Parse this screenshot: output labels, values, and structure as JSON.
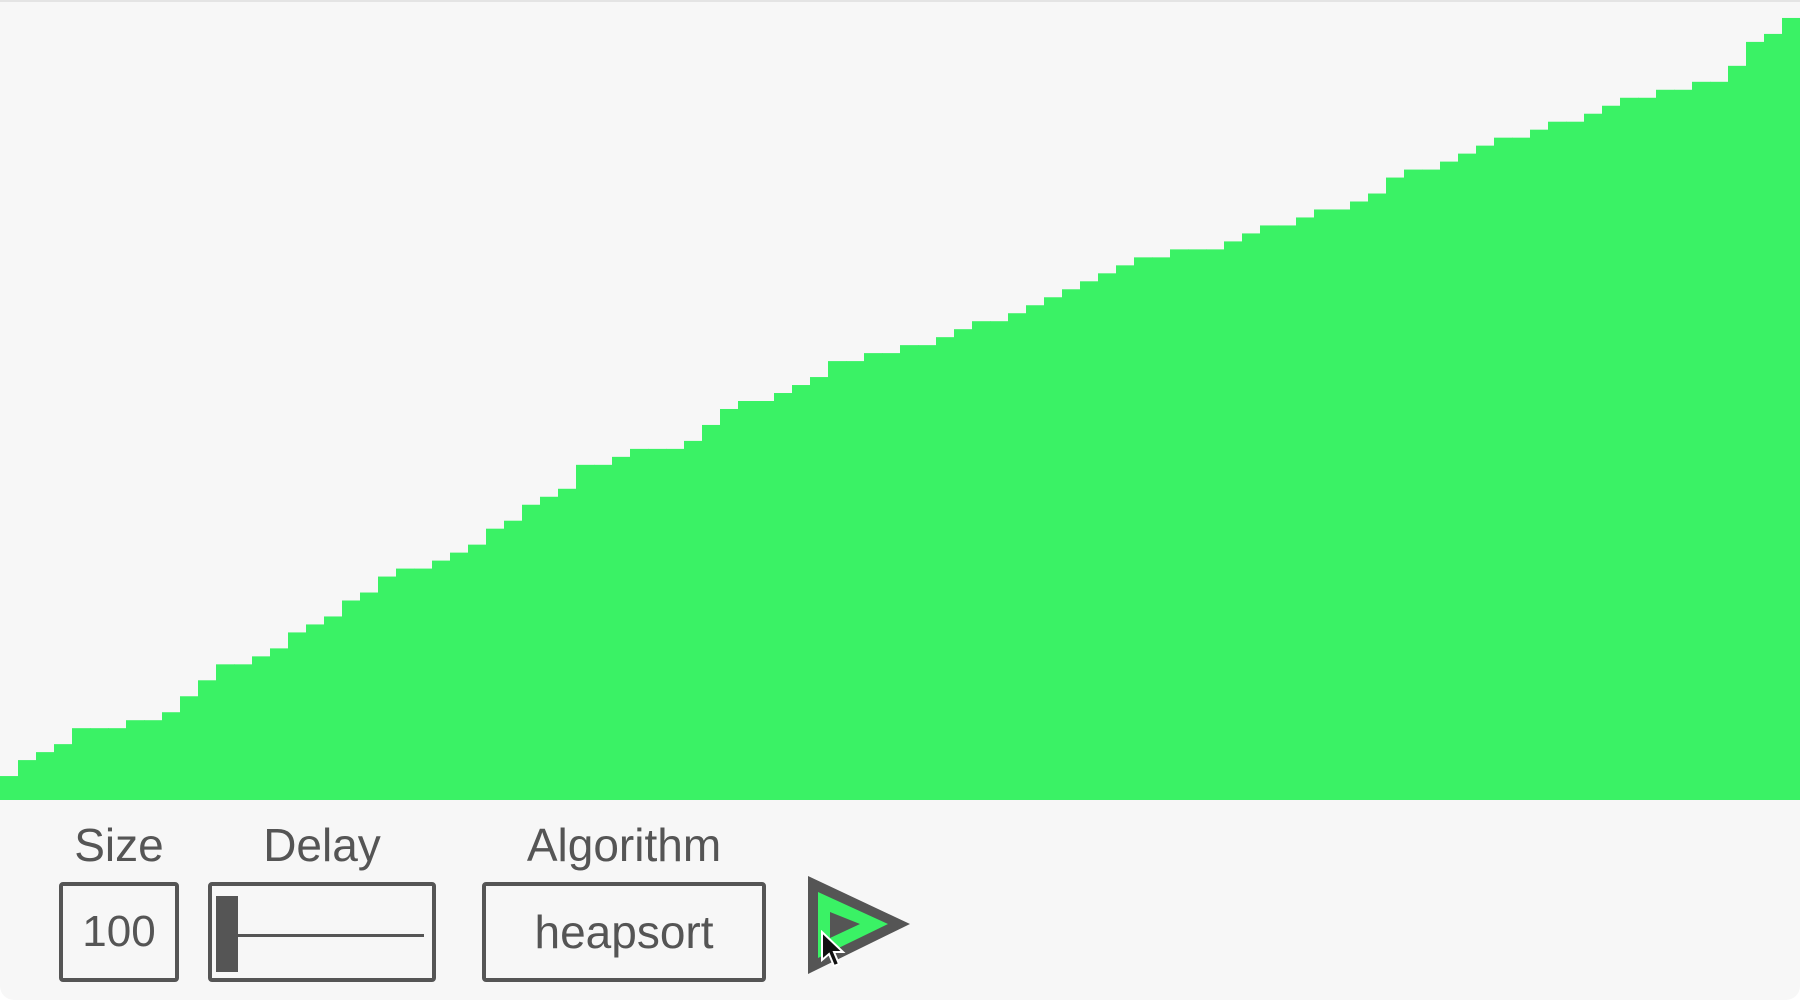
{
  "controls": {
    "size": {
      "label": "Size",
      "value": "100"
    },
    "delay": {
      "label": "Delay",
      "value": 0
    },
    "algorithm": {
      "label": "Algorithm",
      "value": "heapsort"
    },
    "play": {
      "icon": "play-icon"
    }
  },
  "colors": {
    "bar": "#3af265",
    "background": "#f7f7f7",
    "control": "#555555"
  },
  "chart_data": {
    "type": "bar",
    "count": 100,
    "ylim": [
      0,
      100
    ],
    "values": [
      3,
      5,
      6,
      7,
      9,
      9,
      9,
      10,
      10,
      11,
      13,
      15,
      17,
      17,
      18,
      19,
      21,
      22,
      23,
      25,
      26,
      28,
      29,
      29,
      30,
      31,
      32,
      34,
      35,
      37,
      38,
      39,
      42,
      42,
      43,
      44,
      44,
      44,
      45,
      47,
      49,
      50,
      50,
      51,
      52,
      53,
      55,
      55,
      56,
      56,
      57,
      57,
      58,
      59,
      60,
      60,
      61,
      62,
      63,
      64,
      65,
      66,
      67,
      68,
      68,
      69,
      69,
      69,
      70,
      71,
      72,
      72,
      73,
      74,
      74,
      75,
      76,
      78,
      79,
      79,
      80,
      81,
      82,
      83,
      83,
      84,
      85,
      85,
      86,
      87,
      88,
      88,
      89,
      89,
      90,
      90,
      92,
      95,
      96,
      98
    ]
  }
}
